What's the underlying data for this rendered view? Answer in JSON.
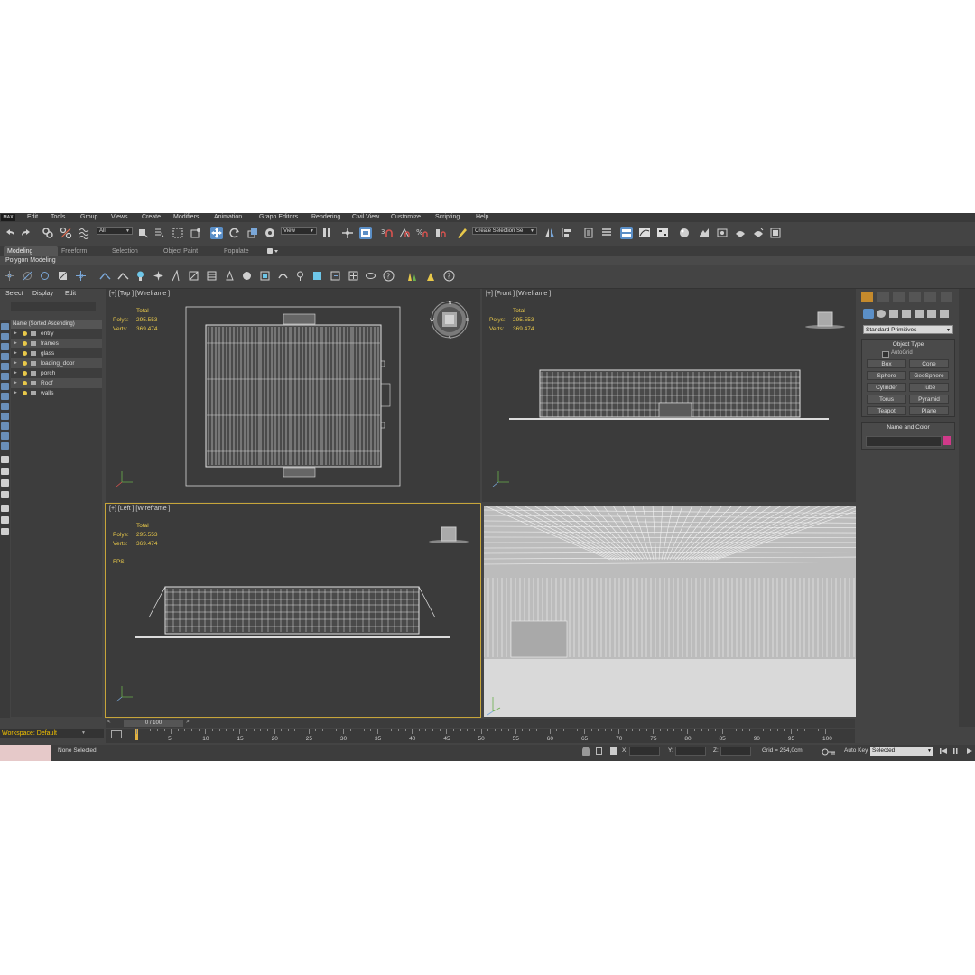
{
  "menubar": {
    "logo": "MAX",
    "items": [
      "Edit",
      "Tools",
      "Group",
      "Views",
      "Create",
      "Modifiers",
      "Animation",
      "Graph Editors",
      "Rendering",
      "Civil View",
      "Customize",
      "Scripting",
      "Help"
    ]
  },
  "toolbar": {
    "selection_filter": "All",
    "reference_coord": "View",
    "named_selection_placeholder": "Create Selection Se"
  },
  "ribbon": {
    "tabs": [
      "Modeling",
      "Freeform",
      "Selection",
      "Object Paint",
      "Populate"
    ],
    "active_tab": "Modeling",
    "panel_label": "Polygon Modeling"
  },
  "scene_explorer": {
    "tabs": [
      "Select",
      "Display",
      "Edit"
    ],
    "header": "Name (Sorted Ascending)",
    "items": [
      "entry",
      "frames",
      "glass",
      "loading_door",
      "porch",
      "Roof",
      "walls"
    ],
    "workspace": "Workspace: Default"
  },
  "viewports": {
    "top": {
      "label": "[+] [Top ] [Wireframe ]",
      "total": "Total",
      "polys_label": "Polys:",
      "polys": "295.553",
      "verts_label": "Verts:",
      "verts": "369.474"
    },
    "front": {
      "label": "[+] [Front ] [Wireframe ]",
      "total": "Total",
      "polys_label": "Polys:",
      "polys": "295.553",
      "verts_label": "Verts:",
      "verts": "369.474"
    },
    "left": {
      "label": "[+] [Left ] [Wireframe ]",
      "total": "Total",
      "polys_label": "Polys:",
      "polys": "295.553",
      "verts_label": "Verts:",
      "verts": "369.474",
      "fps_label": "FPS:"
    }
  },
  "command_panel": {
    "dropdown": "Standard Primitives",
    "object_type_title": "Object Type",
    "autogrid": "AutoGrid",
    "buttons": [
      "Box",
      "Cone",
      "Sphere",
      "GeoSphere",
      "Cylinder",
      "Tube",
      "Torus",
      "Pyramid",
      "Teapot",
      "Plane"
    ],
    "name_color_title": "Name and Color",
    "swatch_color": "#d03a8a"
  },
  "timeline": {
    "frame_counter": "0 / 100",
    "ticks": [
      "5",
      "10",
      "15",
      "20",
      "25",
      "30",
      "35",
      "40",
      "45",
      "50",
      "55",
      "60",
      "65",
      "70",
      "75",
      "80",
      "85",
      "90",
      "95",
      "100"
    ]
  },
  "status": {
    "selection": "None Selected",
    "x_label": "X:",
    "y_label": "Y:",
    "z_label": "Z:",
    "grid": "Grid = 254,0cm",
    "auto_key": "Auto Key",
    "key_mode": "Selected"
  },
  "colors": {
    "accent_blue": "#5b8fc7",
    "stat_yellow": "#e8c84a",
    "active_viewport": "#c7a53a",
    "workspace_text": "#f0c000"
  }
}
